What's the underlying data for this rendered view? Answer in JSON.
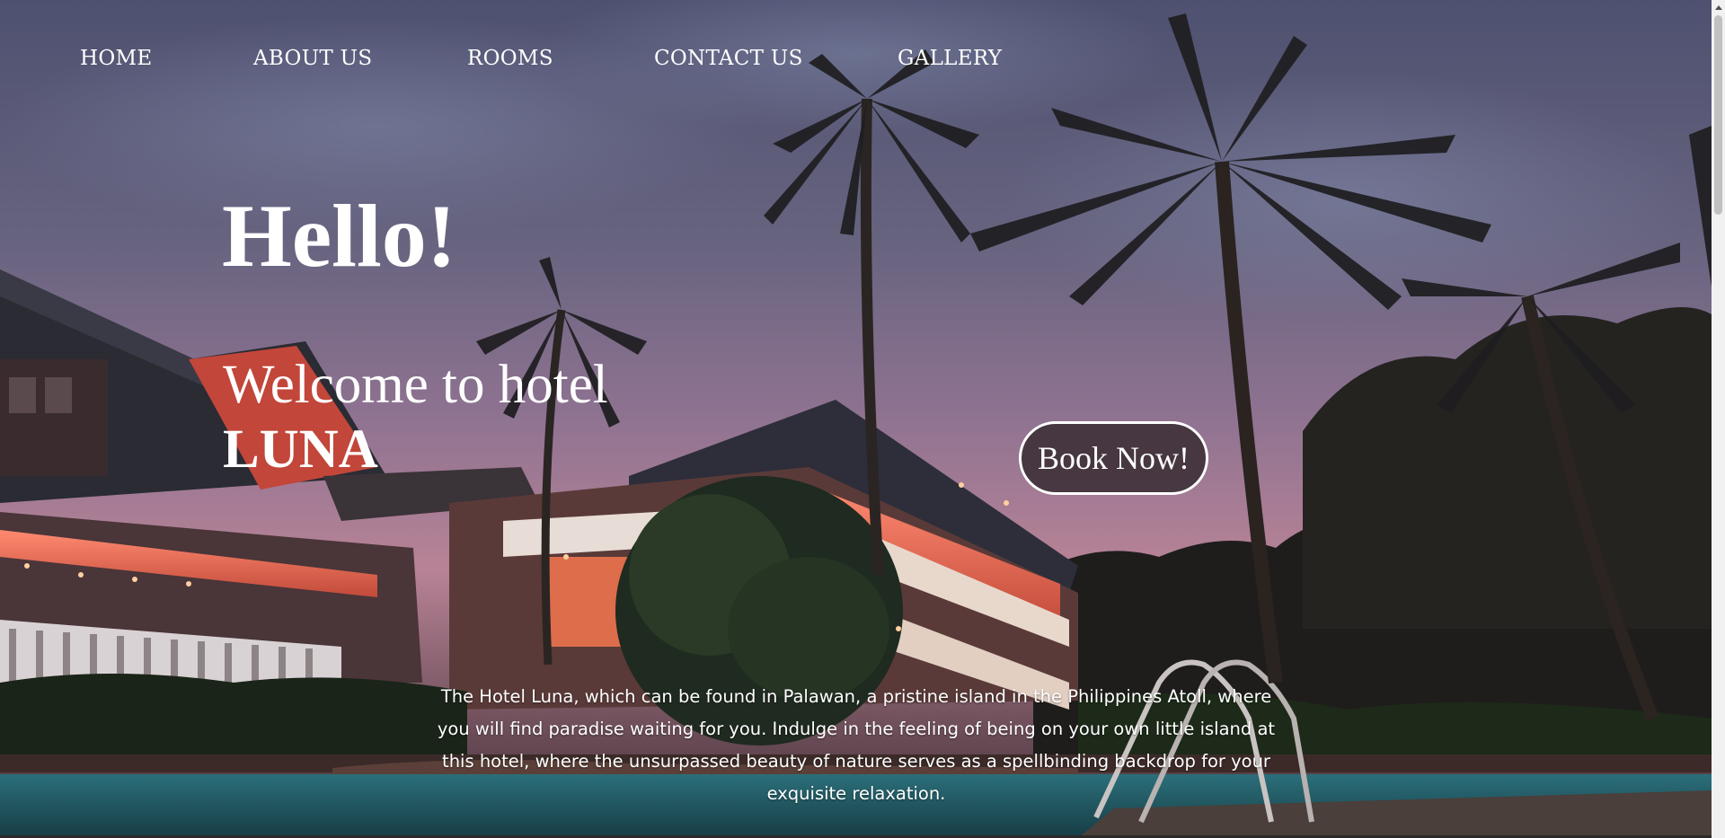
{
  "nav": {
    "items": [
      {
        "label": "Home"
      },
      {
        "label": "About Us"
      },
      {
        "label": "Rooms"
      },
      {
        "label": "Contact Us"
      },
      {
        "label": "Gallery"
      }
    ]
  },
  "hero": {
    "greeting": "Hello!",
    "welcome": "Welcome to hotel",
    "hotel_name": "LUNA",
    "book_button": "Book Now!",
    "description": "The Hotel Luna, which can be found in Palawan, a pristine island in the Philippines Atoll, where you will find paradise waiting for you. Indulge in the feeling of being on your own little island at this hotel, where the unsurpassed beauty of nature serves as a spellbinding backdrop for your exquisite relaxation."
  },
  "colors": {
    "sky_top": "#555773",
    "sky_mid": "#8a6f8c",
    "sky_horizon": "#c58a99",
    "button_bg": "#40323a",
    "text": "#ffffff"
  },
  "background": {
    "icon": "hotel-night-photo"
  }
}
